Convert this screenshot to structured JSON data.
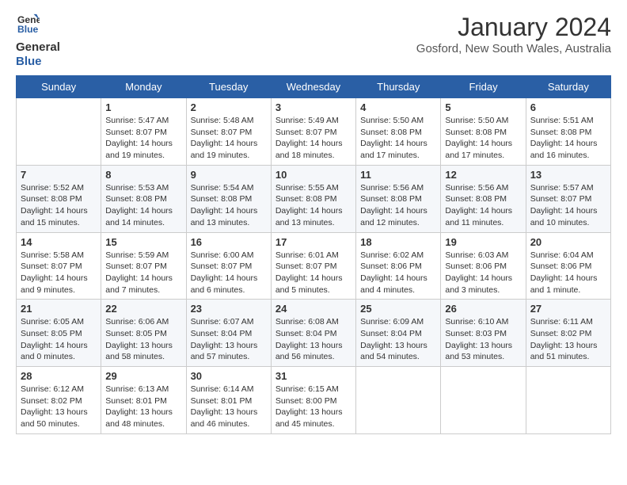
{
  "header": {
    "logo_line1": "General",
    "logo_line2": "Blue",
    "month_title": "January 2024",
    "location": "Gosford, New South Wales, Australia"
  },
  "weekdays": [
    "Sunday",
    "Monday",
    "Tuesday",
    "Wednesday",
    "Thursday",
    "Friday",
    "Saturday"
  ],
  "weeks": [
    [
      {
        "num": "",
        "info": ""
      },
      {
        "num": "1",
        "info": "Sunrise: 5:47 AM\nSunset: 8:07 PM\nDaylight: 14 hours\nand 19 minutes."
      },
      {
        "num": "2",
        "info": "Sunrise: 5:48 AM\nSunset: 8:07 PM\nDaylight: 14 hours\nand 19 minutes."
      },
      {
        "num": "3",
        "info": "Sunrise: 5:49 AM\nSunset: 8:07 PM\nDaylight: 14 hours\nand 18 minutes."
      },
      {
        "num": "4",
        "info": "Sunrise: 5:50 AM\nSunset: 8:08 PM\nDaylight: 14 hours\nand 17 minutes."
      },
      {
        "num": "5",
        "info": "Sunrise: 5:50 AM\nSunset: 8:08 PM\nDaylight: 14 hours\nand 17 minutes."
      },
      {
        "num": "6",
        "info": "Sunrise: 5:51 AM\nSunset: 8:08 PM\nDaylight: 14 hours\nand 16 minutes."
      }
    ],
    [
      {
        "num": "7",
        "info": "Sunrise: 5:52 AM\nSunset: 8:08 PM\nDaylight: 14 hours\nand 15 minutes."
      },
      {
        "num": "8",
        "info": "Sunrise: 5:53 AM\nSunset: 8:08 PM\nDaylight: 14 hours\nand 14 minutes."
      },
      {
        "num": "9",
        "info": "Sunrise: 5:54 AM\nSunset: 8:08 PM\nDaylight: 14 hours\nand 13 minutes."
      },
      {
        "num": "10",
        "info": "Sunrise: 5:55 AM\nSunset: 8:08 PM\nDaylight: 14 hours\nand 13 minutes."
      },
      {
        "num": "11",
        "info": "Sunrise: 5:56 AM\nSunset: 8:08 PM\nDaylight: 14 hours\nand 12 minutes."
      },
      {
        "num": "12",
        "info": "Sunrise: 5:56 AM\nSunset: 8:08 PM\nDaylight: 14 hours\nand 11 minutes."
      },
      {
        "num": "13",
        "info": "Sunrise: 5:57 AM\nSunset: 8:07 PM\nDaylight: 14 hours\nand 10 minutes."
      }
    ],
    [
      {
        "num": "14",
        "info": "Sunrise: 5:58 AM\nSunset: 8:07 PM\nDaylight: 14 hours\nand 9 minutes."
      },
      {
        "num": "15",
        "info": "Sunrise: 5:59 AM\nSunset: 8:07 PM\nDaylight: 14 hours\nand 7 minutes."
      },
      {
        "num": "16",
        "info": "Sunrise: 6:00 AM\nSunset: 8:07 PM\nDaylight: 14 hours\nand 6 minutes."
      },
      {
        "num": "17",
        "info": "Sunrise: 6:01 AM\nSunset: 8:07 PM\nDaylight: 14 hours\nand 5 minutes."
      },
      {
        "num": "18",
        "info": "Sunrise: 6:02 AM\nSunset: 8:06 PM\nDaylight: 14 hours\nand 4 minutes."
      },
      {
        "num": "19",
        "info": "Sunrise: 6:03 AM\nSunset: 8:06 PM\nDaylight: 14 hours\nand 3 minutes."
      },
      {
        "num": "20",
        "info": "Sunrise: 6:04 AM\nSunset: 8:06 PM\nDaylight: 14 hours\nand 1 minute."
      }
    ],
    [
      {
        "num": "21",
        "info": "Sunrise: 6:05 AM\nSunset: 8:05 PM\nDaylight: 14 hours\nand 0 minutes."
      },
      {
        "num": "22",
        "info": "Sunrise: 6:06 AM\nSunset: 8:05 PM\nDaylight: 13 hours\nand 58 minutes."
      },
      {
        "num": "23",
        "info": "Sunrise: 6:07 AM\nSunset: 8:04 PM\nDaylight: 13 hours\nand 57 minutes."
      },
      {
        "num": "24",
        "info": "Sunrise: 6:08 AM\nSunset: 8:04 PM\nDaylight: 13 hours\nand 56 minutes."
      },
      {
        "num": "25",
        "info": "Sunrise: 6:09 AM\nSunset: 8:04 PM\nDaylight: 13 hours\nand 54 minutes."
      },
      {
        "num": "26",
        "info": "Sunrise: 6:10 AM\nSunset: 8:03 PM\nDaylight: 13 hours\nand 53 minutes."
      },
      {
        "num": "27",
        "info": "Sunrise: 6:11 AM\nSunset: 8:02 PM\nDaylight: 13 hours\nand 51 minutes."
      }
    ],
    [
      {
        "num": "28",
        "info": "Sunrise: 6:12 AM\nSunset: 8:02 PM\nDaylight: 13 hours\nand 50 minutes."
      },
      {
        "num": "29",
        "info": "Sunrise: 6:13 AM\nSunset: 8:01 PM\nDaylight: 13 hours\nand 48 minutes."
      },
      {
        "num": "30",
        "info": "Sunrise: 6:14 AM\nSunset: 8:01 PM\nDaylight: 13 hours\nand 46 minutes."
      },
      {
        "num": "31",
        "info": "Sunrise: 6:15 AM\nSunset: 8:00 PM\nDaylight: 13 hours\nand 45 minutes."
      },
      {
        "num": "",
        "info": ""
      },
      {
        "num": "",
        "info": ""
      },
      {
        "num": "",
        "info": ""
      }
    ]
  ]
}
